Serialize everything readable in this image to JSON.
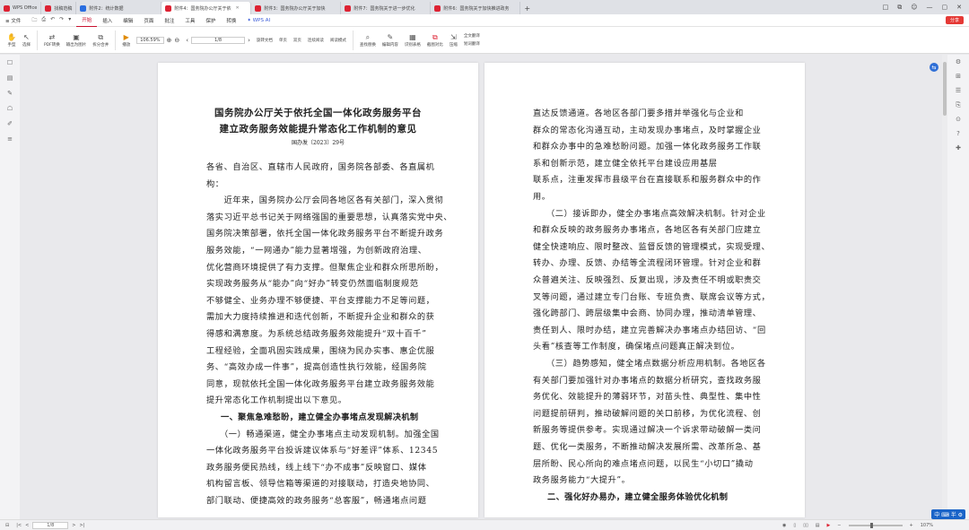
{
  "tabs": [
    {
      "label": "WPS Office",
      "color": "#d23"
    },
    {
      "label": "找稿范稿",
      "color": "#d23"
    },
    {
      "label": "附件2：统计数据",
      "color": "#2a6ee0"
    },
    {
      "label": "附件4：国务院办公厅关于依",
      "color": "#2a6ee0",
      "active": true
    },
    {
      "label": "附件3：国务院办公厅关于加快",
      "color": "#2a6ee0"
    },
    {
      "label": "附件7：国务院关于进一步优化",
      "color": "#2a6ee0"
    },
    {
      "label": "附件6：国务院关于加快推进政务",
      "color": "#2a6ee0"
    }
  ],
  "window_controls": [
    "□",
    "⧉",
    "☺",
    "—",
    "▢",
    "✕"
  ],
  "menubar": {
    "file": "≡ 文件",
    "quick_actions": [
      "🗀",
      "⎙",
      "↶",
      "↷",
      "▾"
    ],
    "items": [
      "开始",
      "插入",
      "编辑",
      "页面",
      "批注",
      "工具",
      "保护",
      "转换",
      "✦ WPS AI"
    ],
    "active": "开始",
    "share": "分享"
  },
  "ribbon": {
    "groups": [
      {
        "icon": "✋",
        "label": "手型"
      },
      {
        "icon": "↖",
        "label": "选择"
      },
      {
        "icon": "⇄",
        "label": "PDF转换"
      },
      {
        "icon": "▣",
        "label": "输出为图片"
      },
      {
        "icon": "⧉",
        "label": "拆分合并"
      },
      {
        "icon": "▶",
        "label": "播放"
      }
    ],
    "zoom": "106.59%",
    "page": "1/8",
    "view_buttons": [
      "旋转文档",
      "单页",
      "双页",
      "连续阅读",
      "阅读模式"
    ],
    "tools": [
      "查找替换",
      "编辑内容",
      "识别表格",
      "截图对比",
      "压缩",
      "全文翻译",
      "划词翻译"
    ]
  },
  "leftbar_icons": [
    "☐",
    "▤",
    "✎",
    "☖",
    "✐",
    "≡"
  ],
  "rightbar_icons": [
    "⚙",
    "⊞",
    "☰",
    "⎘",
    "⊙",
    "?",
    "✚"
  ],
  "page1": {
    "title_line1": "国务院办公厅关于依托全国一体化政务服务平台",
    "title_line2": "建立政务服务效能提升常态化工作机制的意见",
    "doc_no": "国办发〔2023〕29号",
    "lines": [
      "各省、自治区、直辖市人民政府，国务院各部委、各直属机",
      "构：",
      "　　近年来，国务院办公厅会同各地区各有关部门，深入贯彻",
      "落实习近平总书记关于网络强国的重要思想，认真落实党中央、",
      "国务院决策部署，依托全国一体化政务服务平台不断提升政务",
      "服务效能，“一网通办”能力显著增强，为创新政府治理、",
      "优化营商环境提供了有力支撑。但聚焦企业和群众所思所盼，",
      "实现政务服务从“能办”向“好办”转变仍然面临制度规范",
      "不够健全、业务办理不够便捷、平台支撑能力不足等问题，",
      "需加大力度持续推进和迭代创新，不断提升企业和群众的获",
      "得感和满意度。为系统总结政务服务效能提升“双十百千”",
      "工程经验，全面巩固实践成果，围绕为民办实事、惠企优服",
      "务、“高效办成一件事”，提高创造性执行效能，经国务院",
      "同意，现就依托全国一体化政务服务平台建立政务服务效能",
      "提升常态化工作机制提出以下意见。"
    ],
    "heading1": "一、聚焦急难愁盼，建立健全办事堵点发现解决机制",
    "lines2": [
      "　　（一）畅通渠道，健全办事堵点主动发现机制。加强全国",
      "一体化政务服务平台投诉建议体系与“好差评”体系、12345",
      "政务服务便民热线，线上线下“办不成事”反映窗口、媒体",
      "机构留言板、领导信箱等渠道的对接联动，打造央地协同、",
      "部门联动、便捷高效的政务服务“总客服”，畅通堵点问题"
    ]
  },
  "page2": {
    "lines": [
      "直达反馈通道。各地区各部门要多措并举强化与企业和",
      "群众的常态化沟通互动，主动发现办事堵点，及时掌握企业",
      "和群众办事中的急难愁盼问题。加强一体化政务服务工作联",
      "系和创新示范，建立健全依托平台建设应用基层",
      "联系点，注重发挥市县级平台在直接联系和服务群众中的作",
      "用。",
      "　　（二）接诉即办，健全办事堵点高效解决机制。针对企业",
      "和群众反映的政务服务办事堵点，各地区各有关部门应建立",
      "健全快速响应、限时整改、监督反馈的管理模式，实现受理、",
      "转办、办理、反馈、办结等全流程闭环管理。针对企业和群",
      "众普遍关注、反映强烈、反复出现，涉及责任不明或职责交",
      "叉等问题，通过建立专门台账、专班负责、联席会议等方式，",
      "强化跨部门、跨层级集中会商、协同办理，推动清单管理、",
      "责任到人、限时办结，建立完善解决办事堵点办结回访、“回",
      "头看”核查等工作制度，确保堵点问题真正解决到位。",
      "　　（三）趋势感知，健全堵点数据分析应用机制。各地区各",
      "有关部门要加强针对办事堵点的数据分析研究，查找政务服",
      "务优化、效能提升的薄弱环节，对苗头性、典型性、集中性",
      "问题提前研判，推动破解问题的关口前移，为优化流程、创",
      "新服务等提供参考。实现通过解决一个诉求带动破解一类问",
      "题、优化一类服务，不断推动解决发展所需、改革所急、基",
      "层所盼、民心所向的难点堵点问题，以民生“小切口”撬动",
      "政务服务能力“大提升”。"
    ],
    "heading2": "二、强化好办易办，建立健全服务体验优化机制"
  },
  "statusbar": {
    "page": "1/8",
    "zoom": "107%",
    "ime": "中 ⌨ 半 ⚙"
  }
}
